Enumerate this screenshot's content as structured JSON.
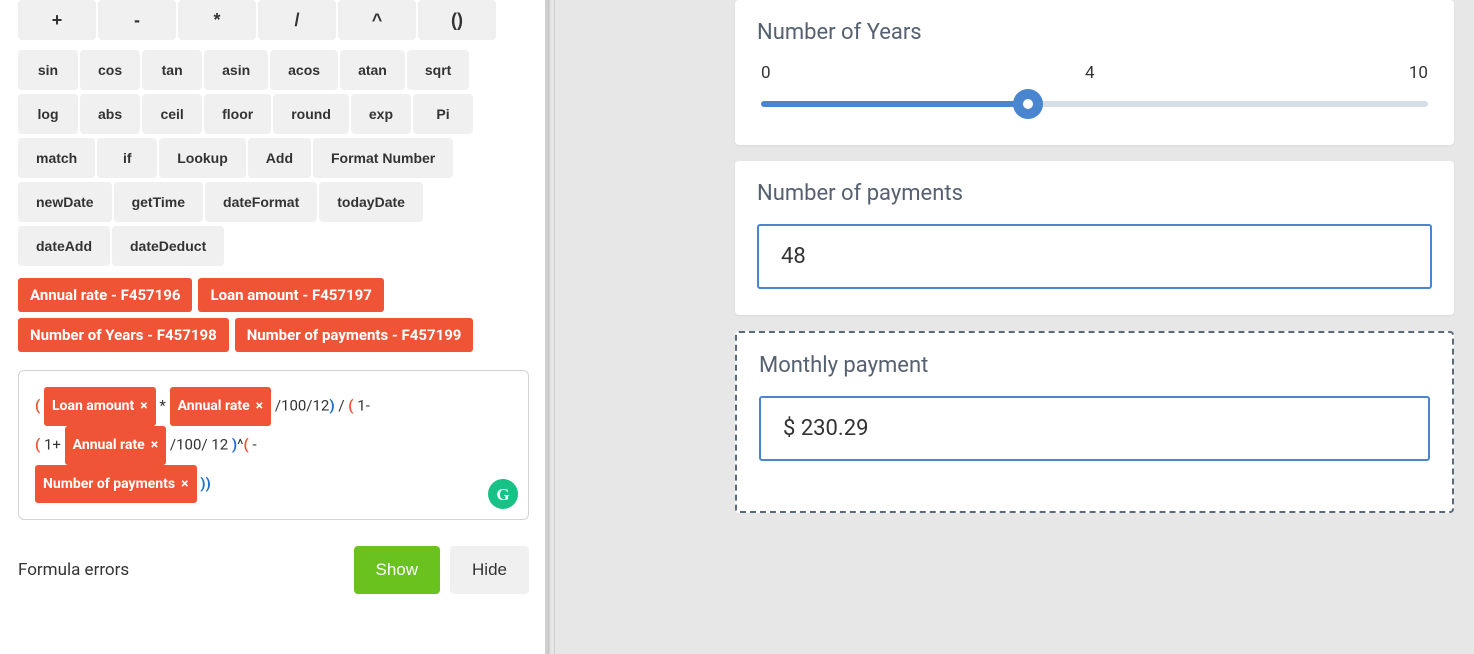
{
  "operators": [
    "+",
    "-",
    "*",
    "/",
    "^",
    "()"
  ],
  "functions": [
    "sin",
    "cos",
    "tan",
    "asin",
    "acos",
    "atan",
    "sqrt",
    "log",
    "abs",
    "ceil",
    "floor",
    "round",
    "exp",
    "Pi",
    "match",
    "if",
    "Lookup",
    "Add",
    "Format Number",
    "newDate",
    "getTime",
    "dateFormat",
    "todayDate",
    "dateAdd",
    "dateDeduct"
  ],
  "field_tags": [
    "Annual rate - F457196",
    "Loan amount - F457197",
    "Number of Years - F457198",
    "Number of payments - F457199"
  ],
  "formula": {
    "tokens": [
      {
        "t": "po"
      },
      {
        "t": "field",
        "label": "Loan amount"
      },
      {
        "t": "txt",
        "v": " * "
      },
      {
        "t": "field",
        "label": "Annual rate"
      },
      {
        "t": "txt",
        "v": " /100/12"
      },
      {
        "t": "pc"
      },
      {
        "t": "txt",
        "v": " / "
      },
      {
        "t": "po"
      },
      {
        "t": "txt",
        "v": "1-"
      },
      {
        "t": "br"
      },
      {
        "t": "po"
      },
      {
        "t": "txt",
        "v": "1+ "
      },
      {
        "t": "field",
        "label": "Annual rate"
      },
      {
        "t": "txt",
        "v": " /100/ 12 "
      },
      {
        "t": "pc"
      },
      {
        "t": "txt",
        "v": "^"
      },
      {
        "t": "po"
      },
      {
        "t": "txt",
        "v": " -"
      },
      {
        "t": "br"
      },
      {
        "t": "field",
        "label": "Number of payments"
      },
      {
        "t": "txt",
        "v": " "
      },
      {
        "t": "pc"
      },
      {
        "t": "pc"
      }
    ],
    "grammarly_glyph": "G"
  },
  "errors_section": {
    "label": "Formula errors",
    "show": "Show",
    "hide": "Hide"
  },
  "preview": {
    "years_card": {
      "title": "Number of Years",
      "min_label": "0",
      "mid_label": "4",
      "max_label": "10",
      "value_ratio": 0.4
    },
    "payments_card": {
      "title": "Number of payments",
      "value": "48"
    },
    "monthly_card": {
      "title": "Monthly payment",
      "value": "$ 230.29"
    }
  }
}
